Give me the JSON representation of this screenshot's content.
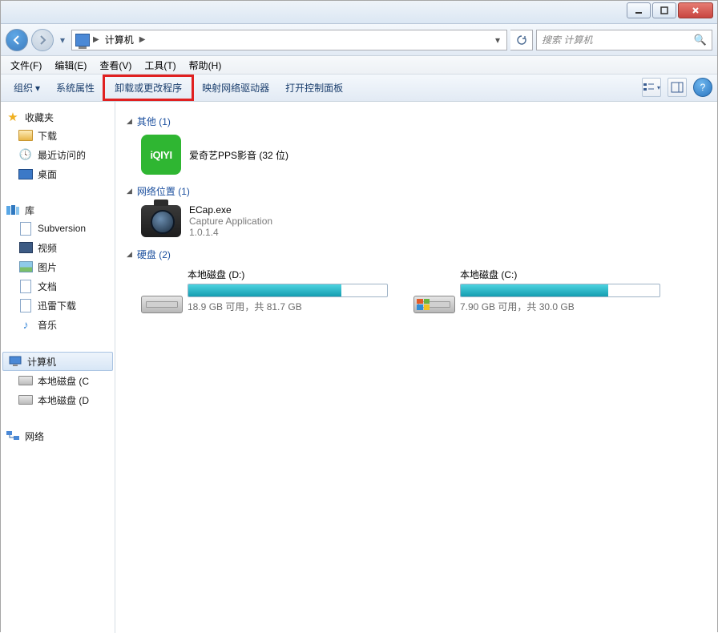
{
  "window": {
    "breadcrumb": "计算机",
    "search_placeholder": "搜索 计算机"
  },
  "menubar": {
    "file": "文件(F)",
    "edit": "编辑(E)",
    "view": "查看(V)",
    "tools": "工具(T)",
    "help": "帮助(H)"
  },
  "toolbar": {
    "organize": "组织",
    "sys_props": "系统属性",
    "uninstall": "卸载或更改程序",
    "map_drive": "映射网络驱动器",
    "open_cp": "打开控制面板"
  },
  "sidebar": {
    "favorites": "收藏夹",
    "downloads": "下载",
    "recent": "最近访问的",
    "desktop": "桌面",
    "libraries": "库",
    "subversion": "Subversion",
    "videos": "视频",
    "pictures": "图片",
    "documents": "文档",
    "xunlei": "迅雷下载",
    "music": "音乐",
    "computer": "计算机",
    "local_c": "本地磁盘 (C",
    "local_d": "本地磁盘 (D",
    "network": "网络"
  },
  "groups": {
    "other": "其他 (1)",
    "netloc": "网络位置 (1)",
    "drives": "硬盘 (2)"
  },
  "items": {
    "iqiyi": {
      "name": "爱奇艺PPS影音 (32 位)",
      "logo": "iQIYI"
    },
    "ecap": {
      "name": "ECap.exe",
      "desc": "Capture Application",
      "ver": "1.0.1.4"
    },
    "drive_d": {
      "title": "本地磁盘 (D:)",
      "free_text": "18.9 GB 可用，共 81.7 GB",
      "fill_pct": 77
    },
    "drive_c": {
      "title": "本地磁盘 (C:)",
      "free_text": "7.90 GB 可用，共 30.0 GB",
      "fill_pct": 74
    }
  }
}
